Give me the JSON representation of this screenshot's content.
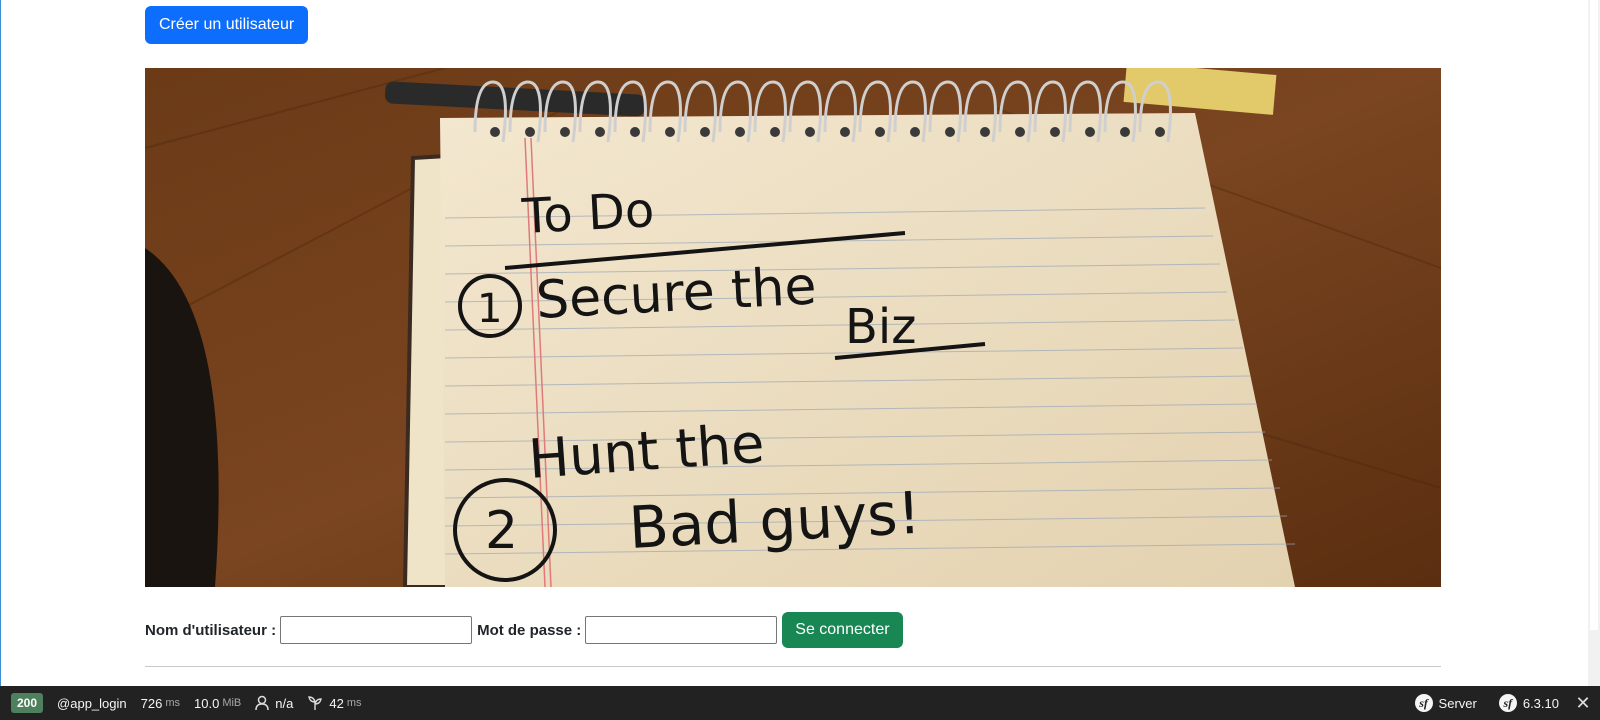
{
  "header": {
    "create_user_label": "Créer un utilisateur"
  },
  "hero": {
    "alt": "To Do notepad",
    "note_title": "To Do",
    "line1": "Secure the",
    "line1b": "Biz",
    "line2": "Hunt the",
    "line2b": "Bad guys!",
    "num1": "1",
    "num2": "2"
  },
  "login": {
    "username_label": "Nom d'utilisateur :",
    "username_value": "",
    "password_label": "Mot de passe :",
    "password_value": "",
    "submit_label": "Se connecter"
  },
  "debug_toolbar": {
    "status_code": "200",
    "route": "@app_login",
    "time_value": "726",
    "time_unit": "ms",
    "memory_value": "10.0",
    "memory_unit": "MiB",
    "user": "n/a",
    "twig_value": "42",
    "twig_unit": "ms",
    "server_label": "Server",
    "symfony_version": "6.3.10"
  },
  "colors": {
    "primary": "#0d6efd",
    "success": "#198754",
    "toolbar_bg": "#222222",
    "status_ok": "#4f805d"
  }
}
